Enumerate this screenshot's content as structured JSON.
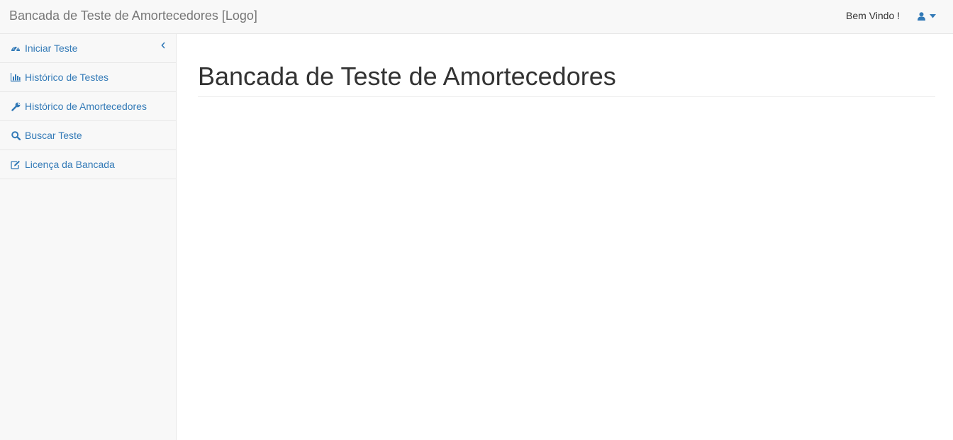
{
  "navbar": {
    "brand": "Bancada de Teste de Amortecedores [Logo]",
    "welcome": "Bem Vindo !",
    "user_icon": "user-icon",
    "caret_icon": "caret-down-icon"
  },
  "sidebar": {
    "items": [
      {
        "label": "Iniciar Teste",
        "icon": "dashboard-icon"
      },
      {
        "label": "Histórico de Testes",
        "icon": "bar-chart-icon"
      },
      {
        "label": "Histórico de Amortecedores",
        "icon": "wrench-icon"
      },
      {
        "label": "Buscar Teste",
        "icon": "search-icon"
      },
      {
        "label": "Licença da Bancada",
        "icon": "edit-icon"
      }
    ],
    "collapse_icon": "chevron-left-icon"
  },
  "main": {
    "title": "Bancada de Teste de Amortecedores"
  },
  "colors": {
    "link": "#337ab7",
    "navbar_bg": "#f8f8f8",
    "border": "#e7e7e7"
  }
}
